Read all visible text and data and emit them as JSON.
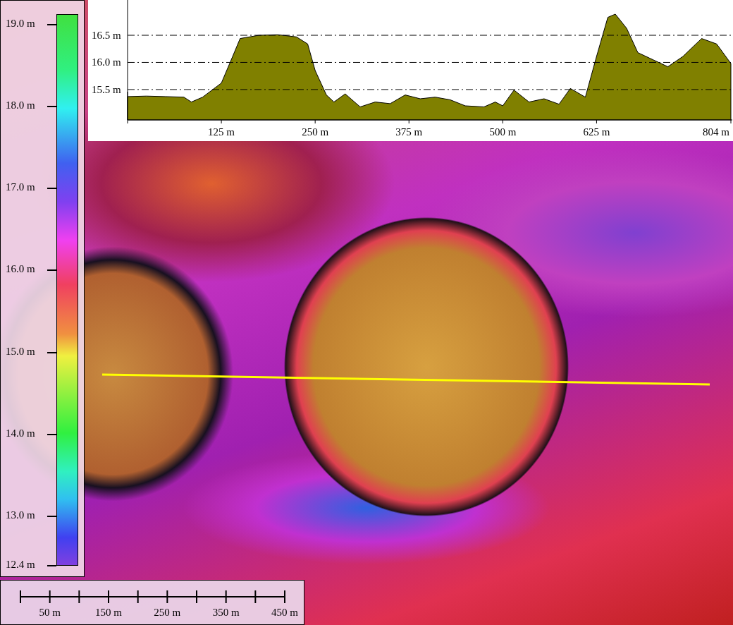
{
  "legend": {
    "ticks": [
      {
        "label": "19.0 m",
        "level": 0.982
      },
      {
        "label": "18.0 m",
        "level": 0.834
      },
      {
        "label": "17.0 m",
        "level": 0.685
      },
      {
        "label": "16.0 m",
        "level": 0.537
      },
      {
        "label": "15.0 m",
        "level": 0.387
      },
      {
        "label": "14.0 m",
        "level": 0.238
      },
      {
        "label": "13.0 m",
        "level": 0.09
      },
      {
        "label": "12.4 m",
        "level": 0
      }
    ]
  },
  "profile": {
    "chart_data": {
      "type": "area",
      "xlim": [
        0,
        804
      ],
      "ylim": [
        14.94,
        17.15
      ],
      "grid": true,
      "x": [
        0,
        25,
        50,
        75,
        85,
        100,
        125,
        140,
        150,
        175,
        200,
        225,
        240,
        250,
        265,
        275,
        290,
        310,
        330,
        350,
        370,
        390,
        410,
        430,
        450,
        475,
        490,
        500,
        515,
        535,
        555,
        575,
        590,
        610,
        625,
        640,
        650,
        665,
        680,
        700,
        720,
        740,
        765,
        785,
        804
      ],
      "series": [
        {
          "color": "#808000",
          "values": [
            15.37,
            15.38,
            15.37,
            15.36,
            15.27,
            15.36,
            15.62,
            16.11,
            16.44,
            16.5,
            16.51,
            16.47,
            16.34,
            15.85,
            15.4,
            15.27,
            15.42,
            15.18,
            15.27,
            15.24,
            15.4,
            15.33,
            15.36,
            15.31,
            15.2,
            15.18,
            15.27,
            15.2,
            15.49,
            15.27,
            15.33,
            15.23,
            15.52,
            15.36,
            16.11,
            16.83,
            16.89,
            16.63,
            16.18,
            16.05,
            15.92,
            16.11,
            16.44,
            16.34,
            15.98
          ]
        }
      ],
      "xticks": [
        {
          "value": 125,
          "label": "125 m"
        },
        {
          "value": 250,
          "label": "250 m"
        },
        {
          "value": 375,
          "label": "375 m"
        },
        {
          "value": 500,
          "label": "500 m"
        },
        {
          "value": 625,
          "label": "625 m"
        },
        {
          "value": 804,
          "label": "804 m"
        }
      ],
      "yticks": [
        {
          "value": 15.5,
          "label": "15.5 m"
        },
        {
          "value": 16,
          "label": "16.0 m"
        },
        {
          "value": 16.5,
          "label": "16.5 m"
        }
      ]
    }
  },
  "scale_bar": {
    "labels": [
      "50 m",
      "150 m",
      "250 m",
      "350 m",
      "450 m"
    ]
  }
}
